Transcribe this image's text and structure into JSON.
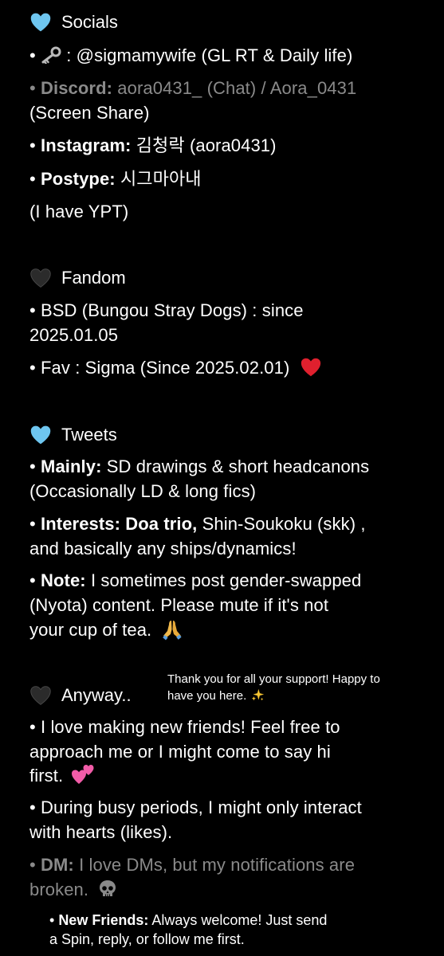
{
  "socials": {
    "heading": "Socials",
    "twitter_rest": " : @sigmamywife (GL RT & Daily life)",
    "discord_label": "Discord:",
    "discord_value": " aora0431_ (Chat) / Aora_0431",
    "discord_value2": "(Screen Share)",
    "instagram_label": "Instagram:",
    "instagram_value": " 김청락 (aora0431)",
    "postype_label": "Postype:",
    "postype_value": " 시그마아내",
    "ypt": "(I have YPT)"
  },
  "fandom": {
    "heading": "Fandom",
    "bsd_line1": "• BSD (Bungou Stray Dogs) : since",
    "bsd_line2": "2025.01.05",
    "fav": "• Fav : Sigma (Since 2025.02.01)"
  },
  "tweets": {
    "heading": "Tweets",
    "mainly_label": "Mainly:",
    "mainly_value": " SD drawings & short headcanons",
    "mainly_value2": "(Occasionally LD & long fics)",
    "interests_label": "Interests: Doa trio,",
    "interests_value": " Shin-Soukoku (skk) ,",
    "interests_value2": "and basically any ships/dynamics!",
    "note_label": "Note:",
    "note_value": " I sometimes post gender-swapped",
    "note_value2": "(Nyota) content. Please mute if it's not",
    "note_value3": "your cup of tea."
  },
  "anyway": {
    "heading": "Anyway..",
    "thanks_line1": "Thank you for all your support! Happy to",
    "thanks_line2": "have you here.",
    "friends_line1": "• I love making new friends! Feel free to",
    "friends_line2": "approach me or I might come to say hi",
    "friends_line3": "first.",
    "busy_line1": "• During busy periods, I might only interact",
    "busy_line2": "with hearts (likes).",
    "dm_label": "DM:",
    "dm_value": " I love DMs, but my notifications are",
    "dm_value2": "broken.",
    "newfriends_label": "New Friends:",
    "newfriends_value": " Always welcome! Just send",
    "newfriends_value2": "a Spin, reply, or follow me first."
  },
  "colors": {
    "background": "#000000",
    "text": "#ffffff",
    "dim_text": "#8a8a8a",
    "blue_heart": "#6ec6f0",
    "black_heart": "#2b2b2b",
    "red_heart": "#e0202e",
    "pink_hearts": "#f25ca8"
  },
  "icons": [
    "blue-heart-icon",
    "key-icon",
    "black-heart-icon",
    "red-heart-icon",
    "praying-hands-icon",
    "sparkles-icon",
    "two-hearts-icon",
    "skull-icon"
  ]
}
